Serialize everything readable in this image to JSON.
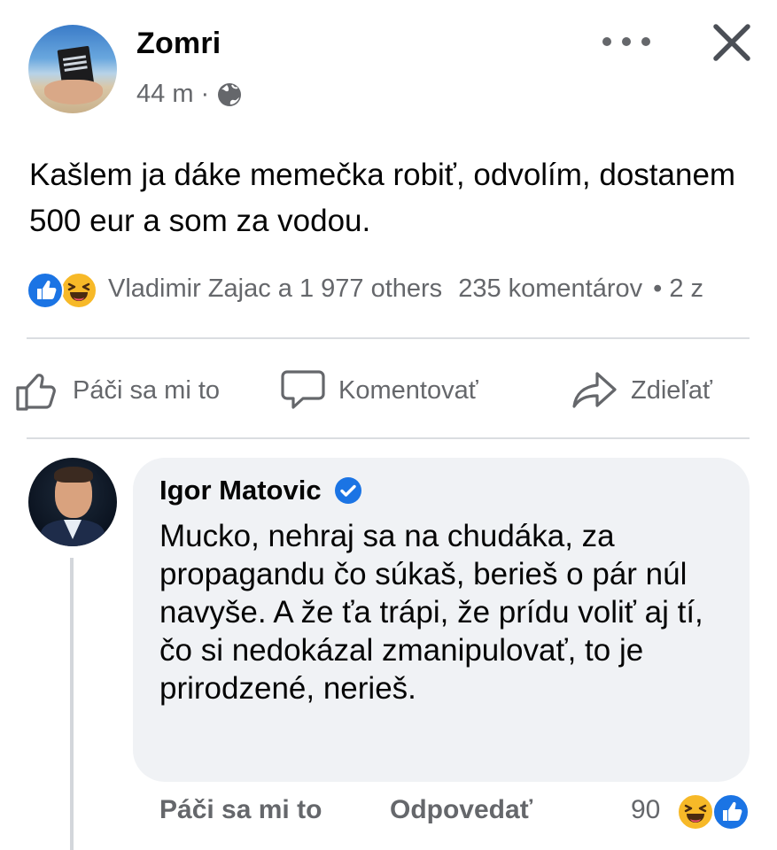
{
  "post": {
    "page_name": "Zomri",
    "time_ago": "44 m",
    "separator": "·",
    "privacy_icon": "globe-icon",
    "body_text": "Kašlem ja dáke memečka robiť, odvolím, dostanem 500 eur a som za vodou.",
    "reactions": {
      "icons": [
        "like-reaction-icon",
        "haha-reaction-icon"
      ],
      "reactors_text": "Vladimir Zajac a 1 977 others",
      "comments_text": "235 komentárov",
      "shares_text": "• 2 z"
    }
  },
  "actions": {
    "like_label": "Páči sa mi to",
    "comment_label": "Komentovať",
    "share_label": "Zdieľať"
  },
  "comment": {
    "author": "Igor Matovic",
    "verified": true,
    "text": "Mucko, nehraj sa na chudáka, za propagandu čo súkaš, berieš o pár núl navyše. A že ťa trápi, že prídu voliť aj tí, čo si nedokázal zmanipulovať, to je prirodzené, nerieš.",
    "like_label": "Páči sa mi to",
    "reply_label": "Odpovedať",
    "reaction_count": "90",
    "reaction_icons": [
      "haha-reaction-icon",
      "like-reaction-icon"
    ]
  },
  "colors": {
    "accent_blue": "#1b74e4",
    "haha_yellow": "#f7b928",
    "secondary_text": "#65676b",
    "bubble_bg": "#f0f2f5"
  }
}
